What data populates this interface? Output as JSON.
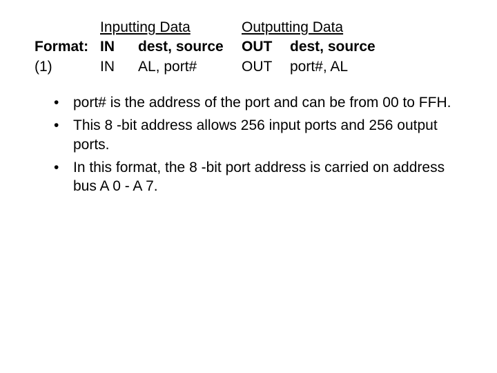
{
  "table": {
    "header_in": "Inputting Data",
    "header_out": "Outputting Data",
    "rows": [
      {
        "label": "Format:",
        "in_mnem": "IN",
        "in_ops": "dest, source",
        "out_mnem": "OUT",
        "out_ops": "dest, source"
      },
      {
        "label": "(1)",
        "in_mnem": "IN",
        "in_ops": "AL, port#",
        "out_mnem": "OUT",
        "out_ops": "port#, AL"
      }
    ]
  },
  "bullets": [
    "port# is the address of the port and can be from 00 to FFH.",
    "This 8 -bit address allows 256 input ports and 256 output ports.",
    "In this format, the 8 -bit port address is carried on address bus A 0 - A 7."
  ]
}
